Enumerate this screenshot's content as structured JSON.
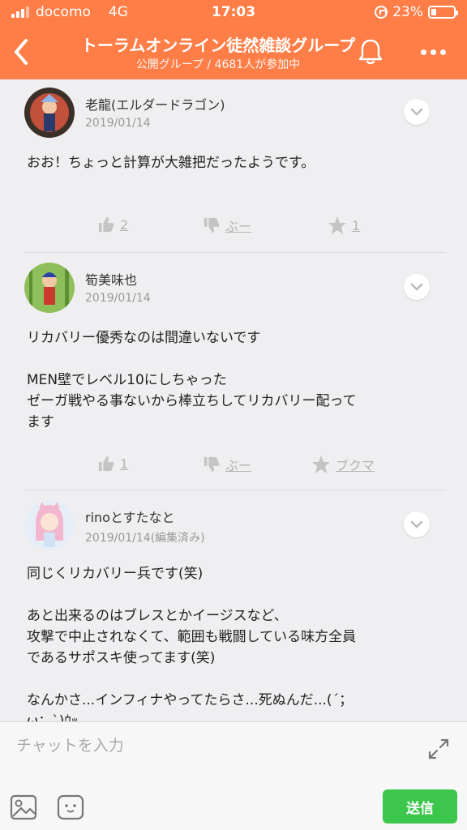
{
  "status_bar": {
    "carrier": "docomo",
    "network": "4G",
    "time": "17:03",
    "battery": "23%",
    "battery_level": 0.23
  },
  "header": {
    "title": "トーラムオンライン徒然雑談グループ",
    "subtitle": "公開グループ / 4681人が参加中"
  },
  "posts": [
    {
      "author": "老龍(エルダードラゴン)",
      "date": "2019/01/14",
      "body": [
        "おお！ちょっと計算が大雑把だったようです。"
      ],
      "likes": "2",
      "boo_label": "ぶー",
      "third_action": "1"
    },
    {
      "author": "筍美味也",
      "date": "2019/01/14",
      "body": [
        "リカバリー優秀なのは間違いないです",
        "",
        "MEN壁でレベル10にしちゃった",
        "ゼーガ戦やる事ないから棒立ちしてリカバリー配って",
        "ます"
      ],
      "likes": "1",
      "boo_label": "ぶー",
      "third_action": "ブクマ"
    },
    {
      "author": "rinoとすたなと",
      "date": "2019/01/14(編集済み)",
      "body": [
        "同じくリカバリー兵です(笑)",
        "",
        "あと出来るのはブレスとかイージスなど、",
        "攻撃で中止されなくて、範囲も戦闘している味方全員",
        "であるサポスキ使ってます(笑)",
        "",
        "なんかさ...インフィナやってたらさ...死ぬんだ...(´；",
        "ω；`)ｳｯ…"
      ]
    }
  ],
  "composer": {
    "placeholder": "チャットを入力",
    "send_label": "送信"
  },
  "colors": {
    "accent": "#ff7e47",
    "send": "#3cc64b",
    "background": "#efeff1"
  },
  "icons": [
    "back-icon",
    "bell-icon",
    "more-icon",
    "chevron-down-icon",
    "thumbs-up-icon",
    "thumbs-down-icon",
    "star-icon",
    "expand-icon",
    "image-icon",
    "emoji-icon"
  ]
}
